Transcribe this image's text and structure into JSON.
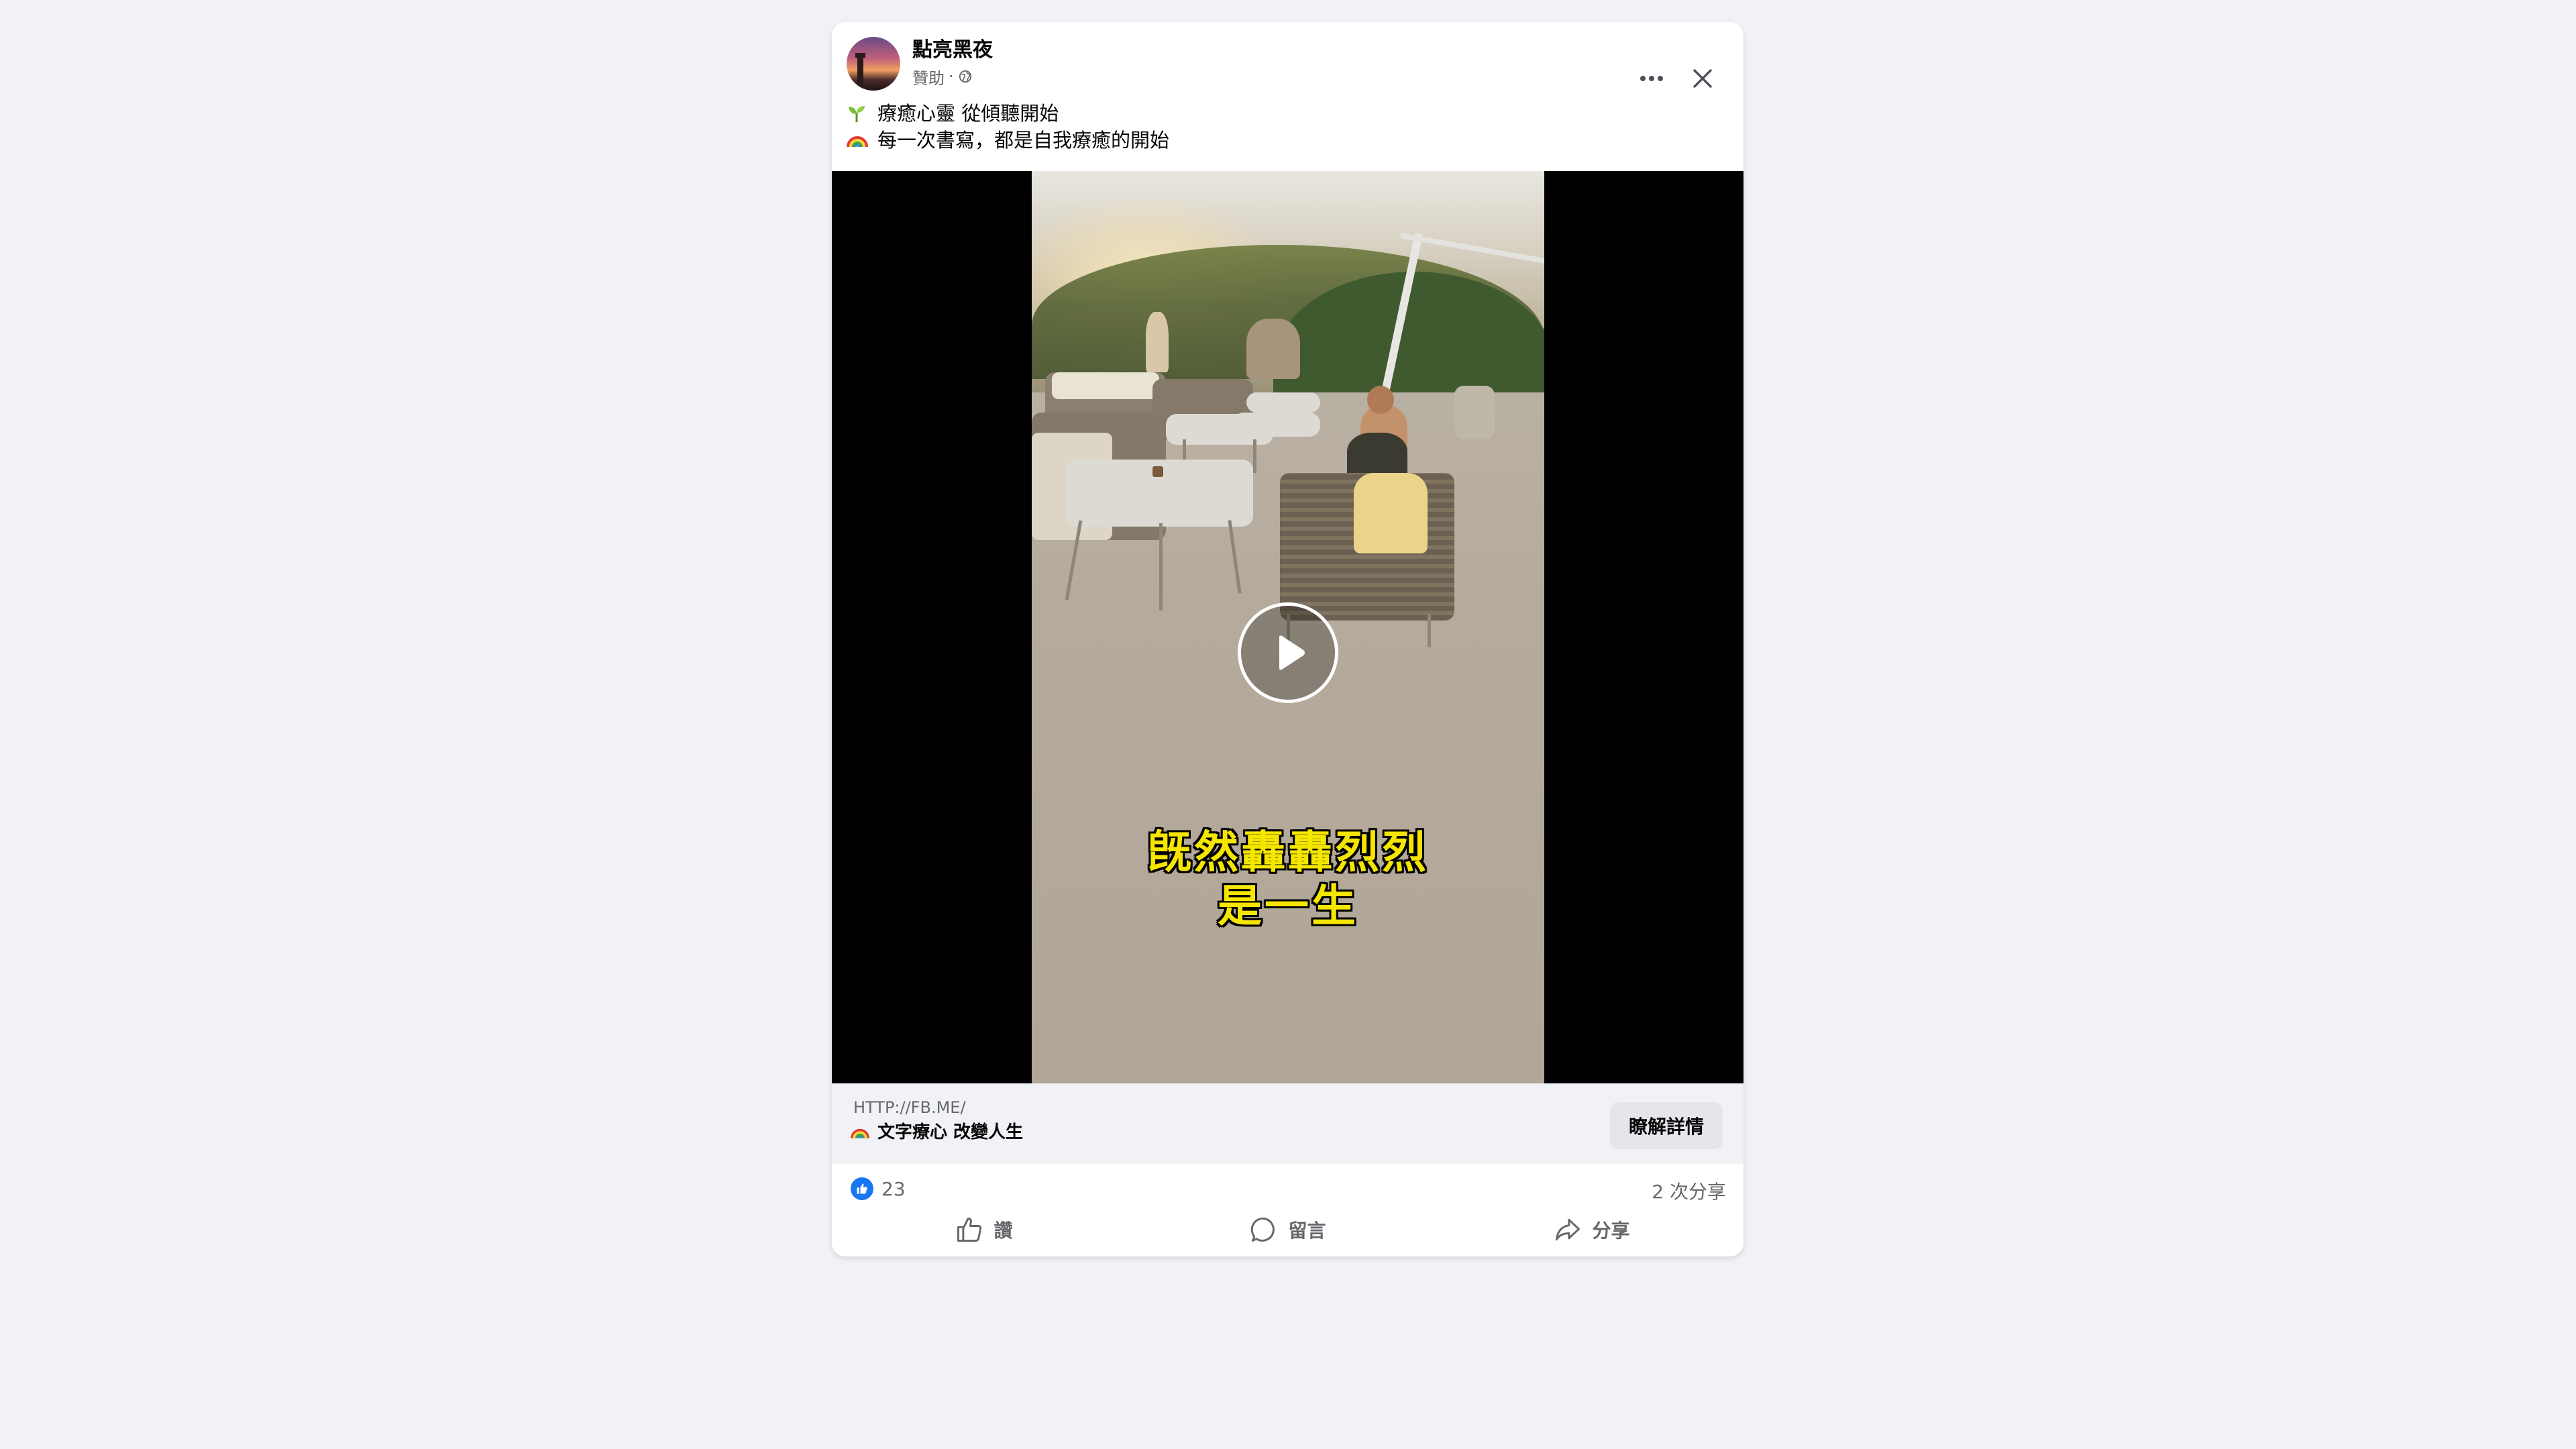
{
  "post": {
    "page_name": "點亮黑夜",
    "sponsored_label": "贊助",
    "separator": "·",
    "lines": [
      {
        "emoji": "seedling-icon",
        "text": "療癒心靈 從傾聽開始"
      },
      {
        "emoji": "rainbow-icon",
        "text": "每一次書寫，都是自我療癒的開始"
      }
    ]
  },
  "video": {
    "subtitle_line1": "旣然轟轟烈烈",
    "subtitle_line2": "是一生"
  },
  "link": {
    "url": "HTTP://FB.ME/",
    "title": "文字療心 改變人生",
    "cta_label": "瞭解詳情"
  },
  "stats": {
    "like_count": "23",
    "share_count": "2 次分享"
  },
  "actions": {
    "like_label": "讚",
    "comment_label": "留言",
    "share_label": "分享"
  },
  "colors": {
    "accent": "#1877f2",
    "background": "#f0f2f5",
    "subtitle": "#f5e600"
  }
}
